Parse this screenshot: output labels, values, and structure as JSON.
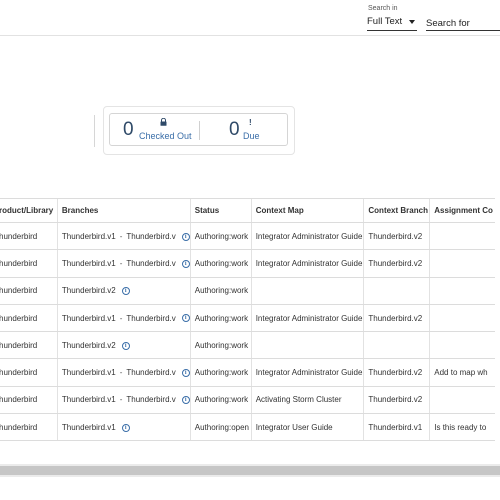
{
  "search": {
    "scope_label": "Search in",
    "scope_value": "Full Text",
    "placeholder": "Search for"
  },
  "stats": {
    "checked_out_count": "0",
    "checked_out_label": "Checked Out",
    "due_count": "0",
    "due_label": "Due"
  },
  "table": {
    "headers": [
      "roduct/Library",
      "Branches",
      "Status",
      "Context Map",
      "Context Branch",
      "Assignment Co"
    ],
    "rows": [
      {
        "product": "hunderbird",
        "branch1": "Thunderbird.v1",
        "branch2": "Thunderbird.v",
        "status": "Authoring:work",
        "context_map": "Integrator Administrator Guide",
        "context_branch": "Thunderbird.v2",
        "assignment": ""
      },
      {
        "product": "hunderbird",
        "branch1": "Thunderbird.v1",
        "branch2": "Thunderbird.v",
        "status": "Authoring:work",
        "context_map": "Integrator Administrator Guide",
        "context_branch": "Thunderbird.v2",
        "assignment": ""
      },
      {
        "product": "hunderbird",
        "branch1": "Thunderbird.v2",
        "branch2": "",
        "status": "Authoring:work",
        "context_map": "",
        "context_branch": "",
        "assignment": ""
      },
      {
        "product": "hunderbird",
        "branch1": "Thunderbird.v1",
        "branch2": "Thunderbird.v",
        "status": "Authoring:work",
        "context_map": "Integrator Administrator Guide",
        "context_branch": "Thunderbird.v2",
        "assignment": ""
      },
      {
        "product": "hunderbird",
        "branch1": "Thunderbird.v2",
        "branch2": "",
        "status": "Authoring:work",
        "context_map": "",
        "context_branch": "",
        "assignment": ""
      },
      {
        "product": "hunderbird",
        "branch1": "Thunderbird.v1",
        "branch2": "Thunderbird.v",
        "status": "Authoring:work",
        "context_map": "Integrator Administrator Guide",
        "context_branch": "Thunderbird.v2",
        "assignment": "Add to map wh"
      },
      {
        "product": "hunderbird",
        "branch1": "Thunderbird.v1",
        "branch2": "Thunderbird.v",
        "status": "Authoring:work",
        "context_map": "Activating Storm Cluster",
        "context_branch": "Thunderbird.v2",
        "assignment": ""
      },
      {
        "product": "hunderbird",
        "branch1": "Thunderbird.v1",
        "branch2": "",
        "status": "Authoring:open",
        "context_map": "Integrator User Guide",
        "context_branch": "Thunderbird.v1",
        "assignment": "Is this ready to"
      }
    ]
  },
  "colors": {
    "accent": "#3a6ea8",
    "stat_number": "#2f4a68"
  }
}
